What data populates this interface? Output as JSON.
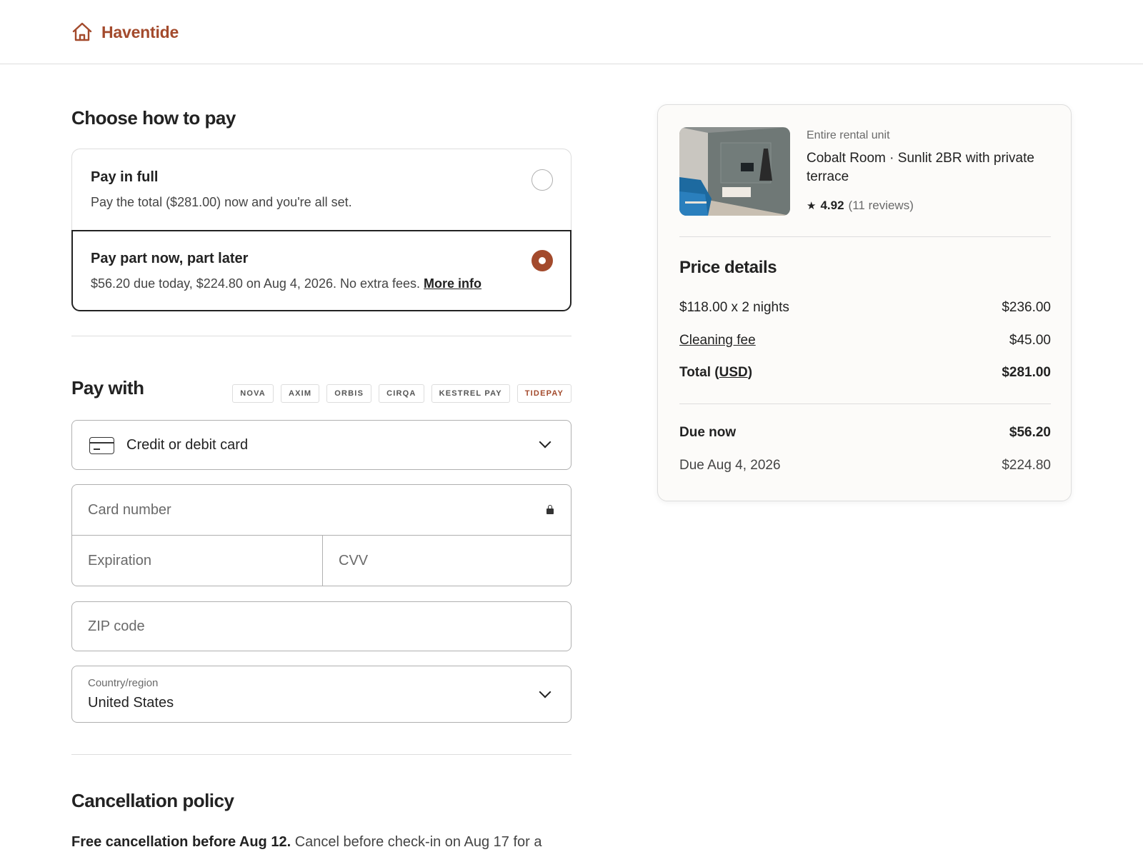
{
  "brand": {
    "name": "Haventide",
    "icon": "home-icon",
    "color": "#a34a2c"
  },
  "payment_plan": {
    "title": "Choose how to pay",
    "options": [
      {
        "title": "Pay in full",
        "description": "Pay the total ($281.00) now and you're all set.",
        "selected": false
      },
      {
        "title": "Pay part now, part later",
        "description": "$56.20 due today, $224.80 on Aug 4, 2026. No extra fees.",
        "link": "More info",
        "selected": true
      }
    ]
  },
  "pay_with": {
    "title": "Pay with",
    "brands": [
      "NOVA",
      "AXIM",
      "ORBIS",
      "CIRQA",
      "KESTREL PAY",
      "TIDEPAY"
    ],
    "method": {
      "label": "Credit or debit card",
      "icon": "credit-card-icon"
    },
    "card_number_placeholder": "Card number",
    "expiration_placeholder": "Expiration",
    "cvv_placeholder": "CVV",
    "zip_placeholder": "ZIP code",
    "country_label": "Country/region",
    "country_value": "United States"
  },
  "cancellation": {
    "title": "Cancellation policy",
    "bold": "Free cancellation before Aug 12.",
    "text": "Cancel before check-in on Aug 17 for a"
  },
  "summary": {
    "listing_type": "Entire rental unit",
    "listing_name": "Cobalt Room · Sunlit 2BR with private terrace",
    "rating": "4.92",
    "reviews": "(11 reviews)",
    "price_title": "Price details",
    "rows": [
      {
        "label": "$118.00 x 2 nights",
        "value": "$236.00"
      },
      {
        "label": "Cleaning fee",
        "value": "$45.00"
      }
    ],
    "total_label_pre": "Total (",
    "total_label_link": "USD",
    "total_label_post": ")",
    "total_value": "$281.00",
    "due_now_label": "Due now",
    "due_now_value": "$56.20",
    "due_later_label": "Due Aug 4, 2026",
    "due_later_value": "$224.80"
  }
}
